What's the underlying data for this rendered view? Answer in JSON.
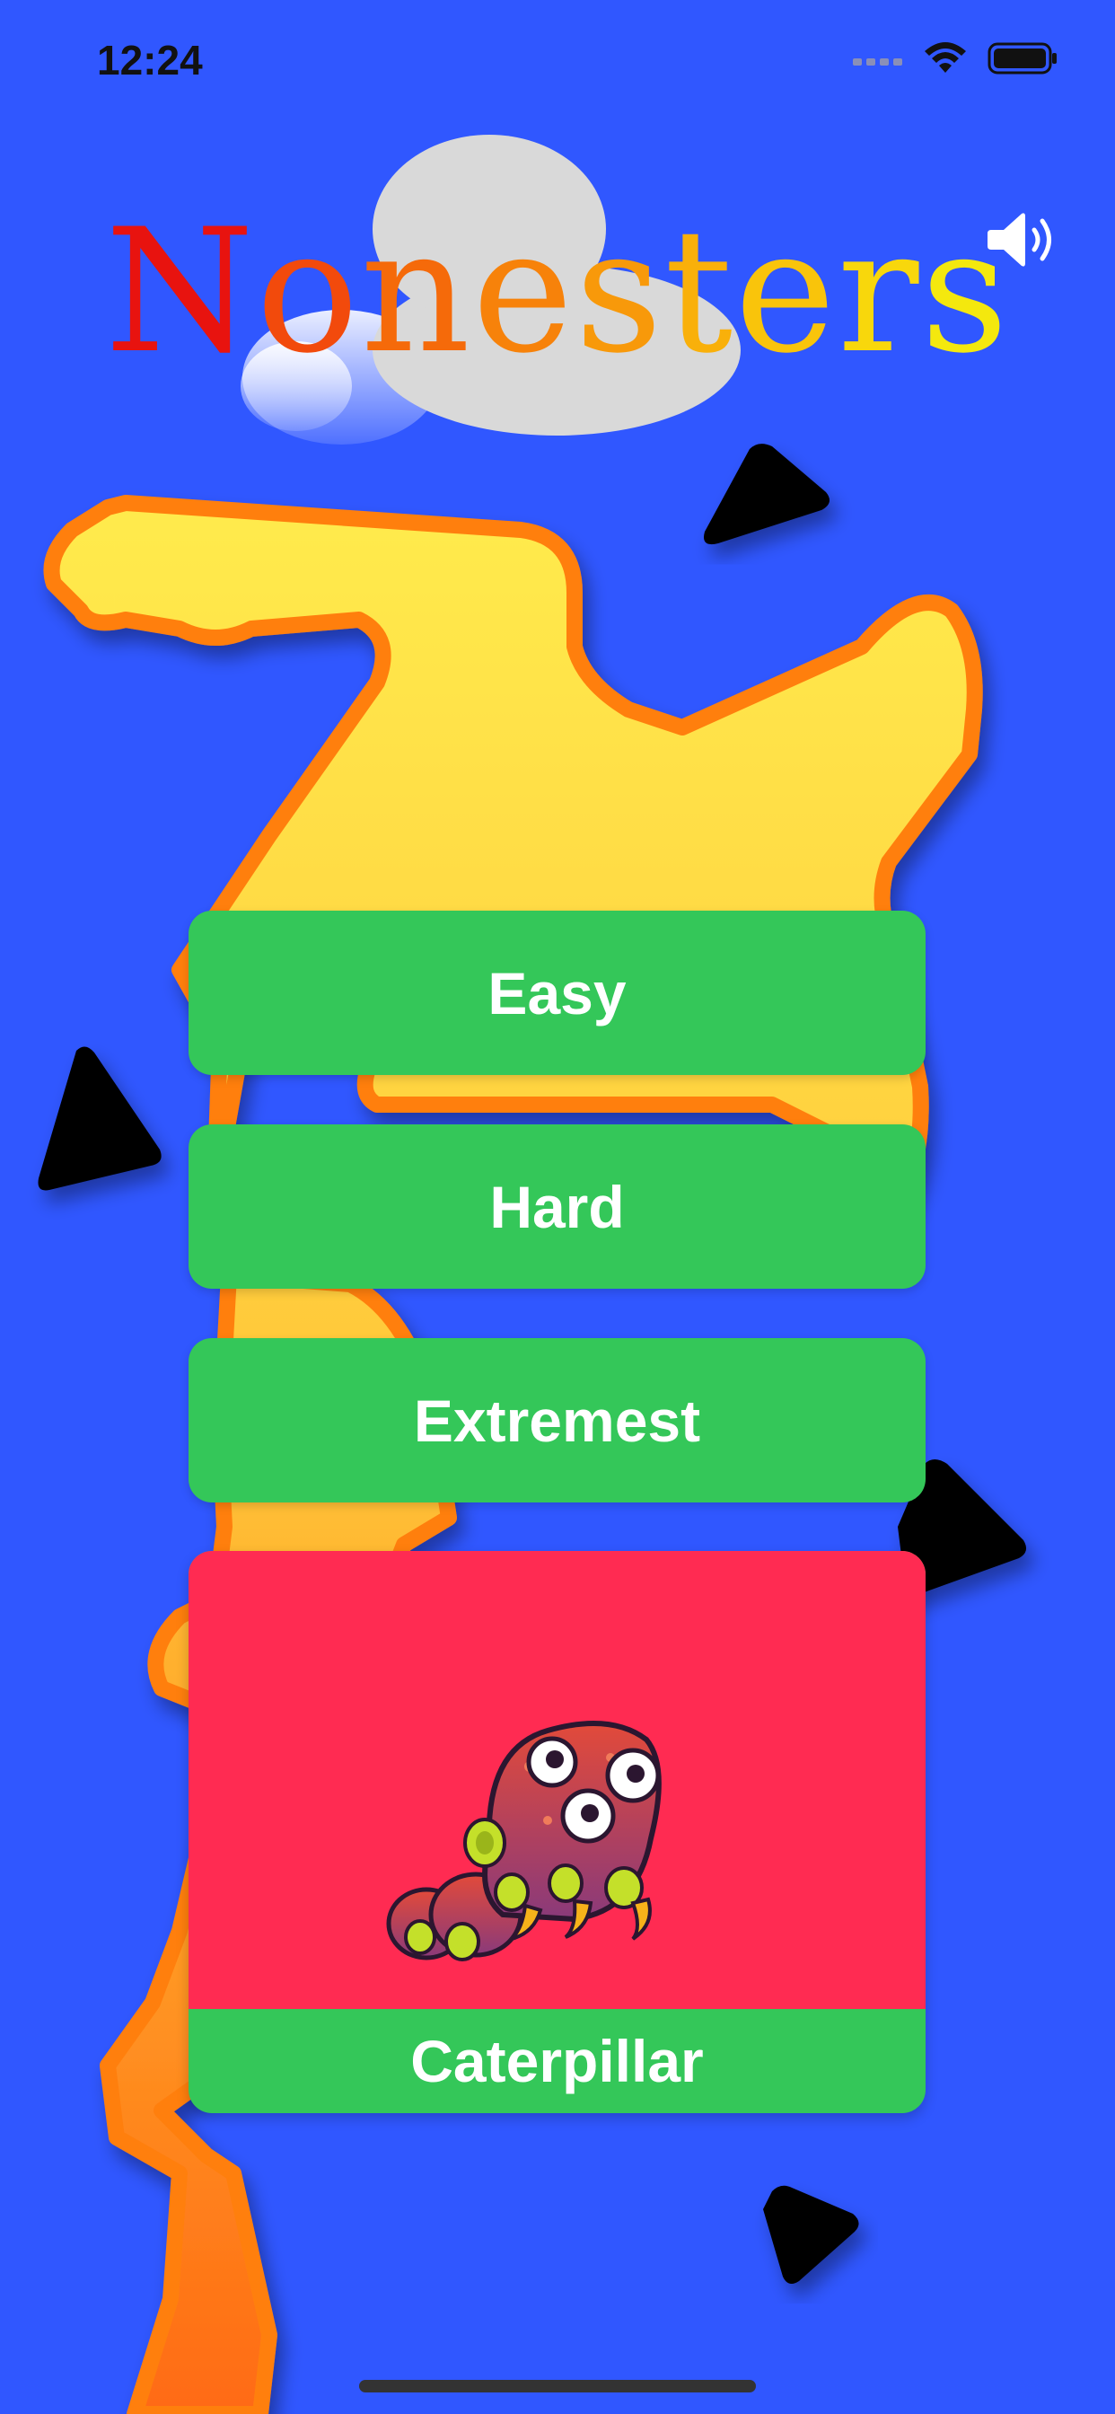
{
  "status": {
    "time": "12:24"
  },
  "app": {
    "title_letters": [
      {
        "ch": "N",
        "color": "#e8130f"
      },
      {
        "ch": "o",
        "color": "#f24a0c"
      },
      {
        "ch": "n",
        "color": "#f56a0a"
      },
      {
        "ch": "e",
        "color": "#f7820a"
      },
      {
        "ch": "s",
        "color": "#f8990a"
      },
      {
        "ch": "t",
        "color": "#f9b00a"
      },
      {
        "ch": "e",
        "color": "#f9c40b"
      },
      {
        "ch": "r",
        "color": "#f8d70c"
      },
      {
        "ch": "s",
        "color": "#f4e80e"
      }
    ],
    "sound_icon": "speaker-wave-icon"
  },
  "menu": {
    "easy_label": "Easy",
    "hard_label": "Hard",
    "extremest_label": "Extremest"
  },
  "character": {
    "name": "Caterpillar",
    "icon": "caterpillar-monster-icon"
  },
  "colors": {
    "background": "#3057ff",
    "button": "#34c759",
    "card": "#ff2b52",
    "blob_yellow": "#ffe14a",
    "blob_orange": "#ff8a1e"
  }
}
